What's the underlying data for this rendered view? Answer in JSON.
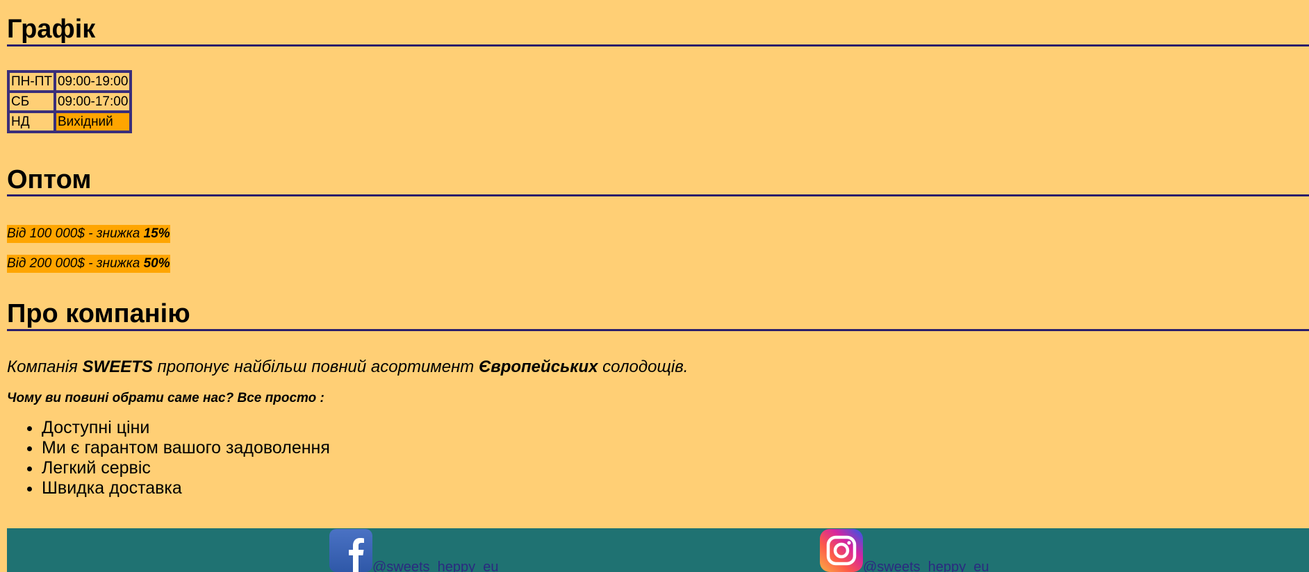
{
  "schedule": {
    "title": "Графік",
    "rows": [
      {
        "day": "ПН-ПТ",
        "hours": "09:00-19:00"
      },
      {
        "day": "СБ",
        "hours": "09:00-17:00"
      },
      {
        "day": "НД",
        "hours": "Вихідний"
      }
    ]
  },
  "wholesale": {
    "title": "Оптом",
    "offers": [
      {
        "text": "Від 100 000$ - знижка ",
        "discount": "15%"
      },
      {
        "text": "Від 200 000$ - знижка ",
        "discount": "50%"
      }
    ]
  },
  "about": {
    "title": "Про компанію",
    "intro": {
      "part1": "Компанія ",
      "brand": "SWEETS",
      "part2": " пропонує найбільш повний асортимент ",
      "highlight": "Європейських",
      "part3": " солодощів."
    },
    "why": "Чому ви повині обрати саме нас? Все просто :",
    "benefits": [
      "Доступні ціни",
      "Ми є гарантом вашого задоволення",
      "Легкий сервіс",
      "Швидка доставка"
    ]
  },
  "footer": {
    "facebook": {
      "icon": "facebook-icon",
      "handle": "@sweets_heppy_eu"
    },
    "instagram": {
      "icon": "instagram-icon",
      "handle": "@sweets_heppy_eu"
    }
  },
  "colors": {
    "background": "#ffcf75",
    "highlight": "#ffa500",
    "rule": "#2b1f6b",
    "footer": "#1f7272",
    "link": "#2b2a80"
  }
}
